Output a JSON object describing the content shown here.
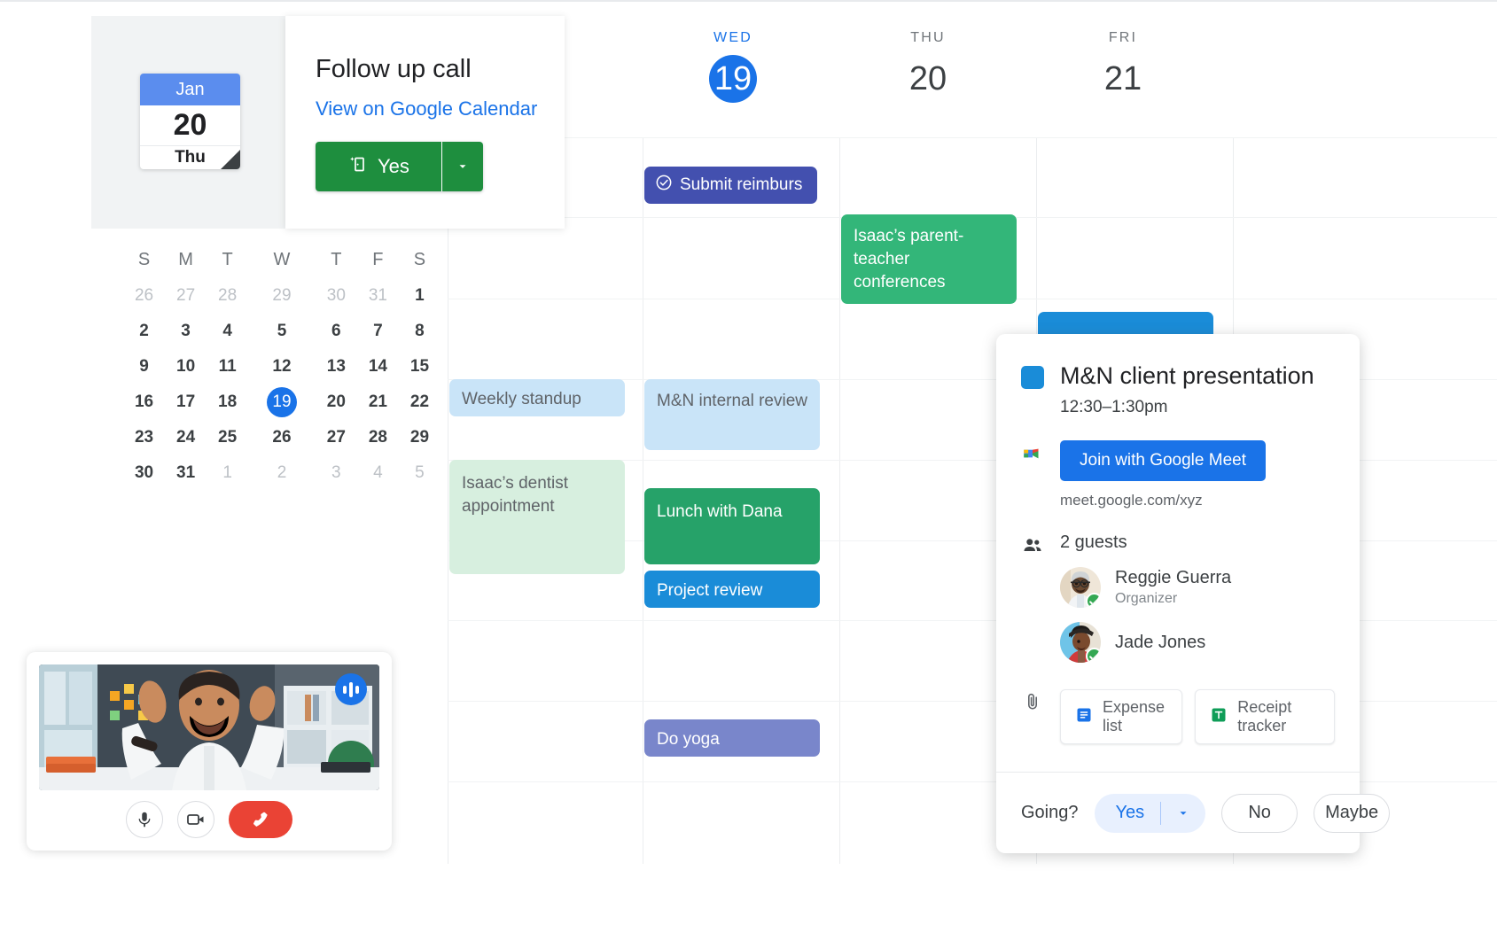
{
  "follow_up": {
    "title": "Follow up call",
    "link": "View on Google Calendar",
    "yes_label": "Yes",
    "date_month": "Jan",
    "date_day": "20",
    "date_weekday": "Thu"
  },
  "mini_calendar": {
    "weekday_headers": [
      "S",
      "M",
      "T",
      "W",
      "T",
      "F",
      "S"
    ],
    "weeks": [
      [
        {
          "d": "26",
          "muted": true
        },
        {
          "d": "27",
          "muted": true
        },
        {
          "d": "28",
          "muted": true
        },
        {
          "d": "29",
          "muted": true
        },
        {
          "d": "30",
          "muted": true
        },
        {
          "d": "31",
          "muted": true
        },
        {
          "d": "1",
          "muted": false
        }
      ],
      [
        {
          "d": "2",
          "muted": false
        },
        {
          "d": "3",
          "muted": false
        },
        {
          "d": "4",
          "muted": false
        },
        {
          "d": "5",
          "muted": false
        },
        {
          "d": "6",
          "muted": false
        },
        {
          "d": "7",
          "muted": false
        },
        {
          "d": "8",
          "muted": false
        }
      ],
      [
        {
          "d": "9",
          "muted": false
        },
        {
          "d": "10",
          "muted": false
        },
        {
          "d": "11",
          "muted": false
        },
        {
          "d": "12",
          "muted": false
        },
        {
          "d": "13",
          "muted": false
        },
        {
          "d": "14",
          "muted": false
        },
        {
          "d": "15",
          "muted": false
        }
      ],
      [
        {
          "d": "16",
          "muted": false
        },
        {
          "d": "17",
          "muted": false
        },
        {
          "d": "18",
          "muted": false
        },
        {
          "d": "19",
          "muted": false,
          "selected": true
        },
        {
          "d": "20",
          "muted": false
        },
        {
          "d": "21",
          "muted": false
        },
        {
          "d": "22",
          "muted": false
        }
      ],
      [
        {
          "d": "23",
          "muted": false
        },
        {
          "d": "24",
          "muted": false
        },
        {
          "d": "25",
          "muted": false
        },
        {
          "d": "26",
          "muted": false
        },
        {
          "d": "27",
          "muted": false
        },
        {
          "d": "28",
          "muted": false
        },
        {
          "d": "29",
          "muted": false
        }
      ],
      [
        {
          "d": "30",
          "muted": false
        },
        {
          "d": "31",
          "muted": false
        },
        {
          "d": "1",
          "muted": true
        },
        {
          "d": "2",
          "muted": true
        },
        {
          "d": "3",
          "muted": true
        },
        {
          "d": "4",
          "muted": true
        },
        {
          "d": "5",
          "muted": true
        }
      ]
    ]
  },
  "week_grid": {
    "days": [
      {
        "dow": "WED",
        "num": "19",
        "today": true
      },
      {
        "dow": "THU",
        "num": "20",
        "today": false
      },
      {
        "dow": "FRI",
        "num": "21",
        "today": false
      }
    ],
    "events": [
      {
        "title": "Submit reimburs",
        "color": "#4350af",
        "text": "#ffffff",
        "task": true
      },
      {
        "title": "Isaac’s parent-teacher conferences",
        "color": "#33b679",
        "text": "#ffffff"
      },
      {
        "title": "Weekly standup",
        "color": "#c9e4f8",
        "text": "#5f6368"
      },
      {
        "title": "M&N internal review",
        "color": "#c9e4f8",
        "text": "#5f6368"
      },
      {
        "title": "Isaac’s dentist appointment",
        "color": "#d7efdf",
        "text": "#5f6368"
      },
      {
        "title": "Lunch with Dana",
        "color": "#26a269",
        "text": "#ffffff"
      },
      {
        "title": "Project review",
        "color": "#1a8cd8",
        "text": "#ffffff"
      },
      {
        "title": "Do yoga",
        "color": "#7986cb",
        "text": "#ffffff"
      },
      {
        "title": "",
        "color": "#1a8cd8",
        "text": "#ffffff"
      }
    ]
  },
  "event_popup": {
    "title": "M&N client presentation",
    "time": "12:30–1:30pm",
    "color": "#1a8cd8",
    "meet_button": "Join with Google Meet",
    "meet_url": "meet.google.com/xyz",
    "guests_count": "2 guests",
    "guests": [
      {
        "name": "Reggie Guerra",
        "role": "Organizer"
      },
      {
        "name": "Jade Jones",
        "role": ""
      }
    ],
    "attachments": [
      {
        "label": "Expense list",
        "icon": "google-docs-icon"
      },
      {
        "label": "Receipt tracker",
        "icon": "google-sheets-icon"
      }
    ],
    "rsvp_prompt": "Going?",
    "rsvp_yes": "Yes",
    "rsvp_no": "No",
    "rsvp_maybe": "Maybe"
  },
  "video_call": {
    "mic_icon": "microphone-icon",
    "camera_icon": "video-camera-icon",
    "hangup_icon": "end-call-icon",
    "audio_icon": "audio-levels-icon"
  }
}
